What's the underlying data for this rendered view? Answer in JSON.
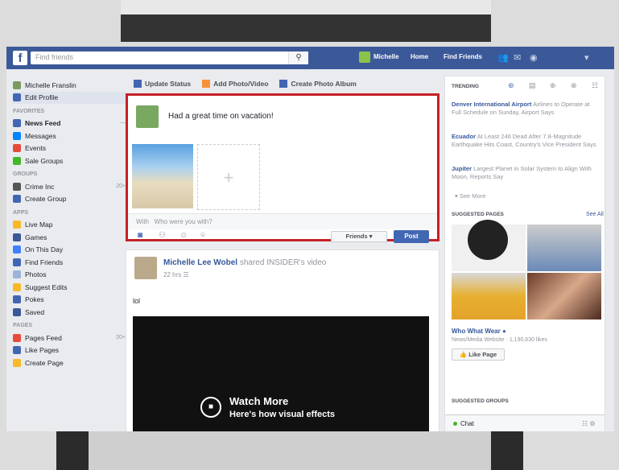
{
  "topbar": {
    "search_placeholder": "Find friends",
    "user_name": "Michelle",
    "home_label": "Home",
    "find_friends_label": "Find Friends"
  },
  "left_nav": {
    "profile_name": "Michelle Franslin",
    "edit_profile": "Edit Profile",
    "favorites_header": "FAVORITES",
    "favorites": [
      "News Feed",
      "Messages",
      "Events",
      "Sale Groups"
    ],
    "groups_header": "GROUPS",
    "groups": [
      {
        "label": "Crime Inc",
        "count": "20+"
      },
      {
        "label": "Create Group",
        "count": ""
      }
    ],
    "apps_header": "APPS",
    "apps": [
      "Live Map",
      "Games",
      "On This Day",
      "Find Friends",
      "Photos",
      "Suggest Edits",
      "Pokes",
      "Saved"
    ],
    "pages_header": "PAGES",
    "pages": [
      {
        "label": "Pages Feed",
        "count": "20+"
      },
      {
        "label": "Like Pages",
        "count": ""
      },
      {
        "label": "Create Page",
        "count": ""
      }
    ]
  },
  "composer": {
    "actions": [
      "Update Status",
      "Add Photo/Video",
      "Create Photo Album"
    ],
    "text": "Had a great time on vacation!",
    "with_label": "With",
    "with_placeholder": "Who were you with?",
    "audience": "Friends ▾",
    "post_label": "Post"
  },
  "feed": {
    "author": "Michelle Lee Wobel",
    "shared_text": "shared INSIDER's video",
    "time": "22 hrs",
    "body": "lol",
    "video_title": "Watch More",
    "video_subtitle": "Here's how visual effects"
  },
  "right": {
    "trending_header": "TRENDING",
    "trends": [
      {
        "title": "Denver International Airport",
        "text": "Airlines to Operate at Full Schedule on Sunday, Airport Says"
      },
      {
        "title": "Ecuador",
        "text": "At Least 246 Dead After 7.8-Magnitude Earthquake Hits Coast, Country's Vice President Says"
      },
      {
        "title": "Jupiter",
        "text": "Largest Planet in Solar System to Align With Moon, Reports Say"
      }
    ],
    "see_more": "See More",
    "suggested_pages_header": "SUGGESTED PAGES",
    "see_all": "See All",
    "page_name": "Who What Wear",
    "page_sub": "News/Media Website · 1,190,630 likes",
    "like_page": "Like Page",
    "suggested_groups_header": "SUGGESTED GROUPS",
    "chat_label": "Chat"
  },
  "colors": {
    "fb_blue": "#3b5998",
    "highlight_red": "#c42026"
  }
}
